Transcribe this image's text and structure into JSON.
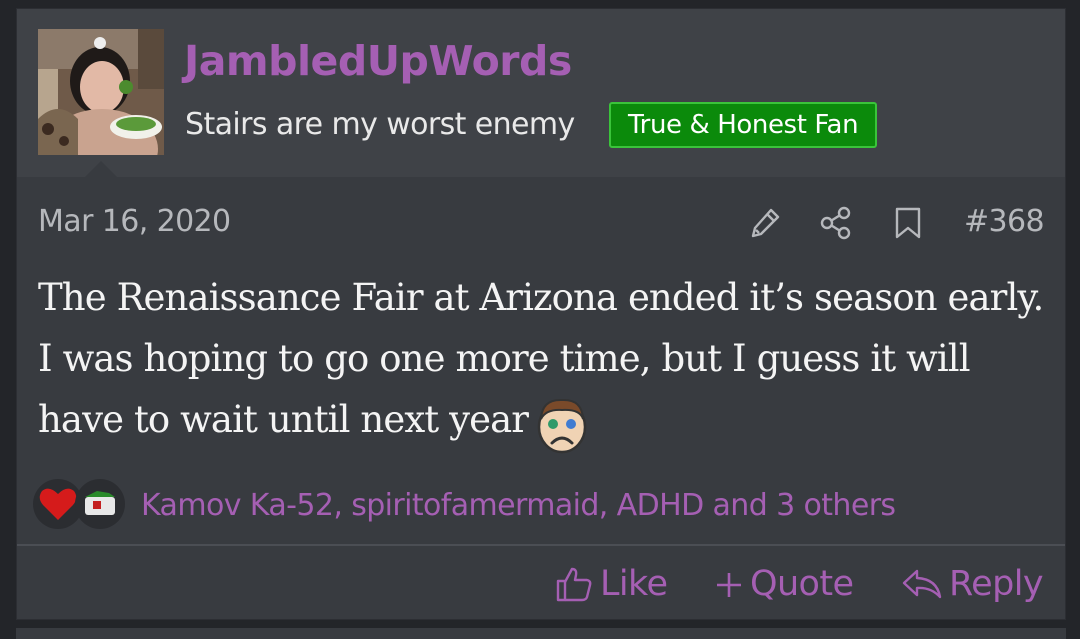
{
  "user": {
    "name": "JambledUpWords",
    "title": "Stairs are my worst enemy",
    "banner": "True & Honest Fan"
  },
  "post": {
    "date": "Mar 16, 2020",
    "number": "#368",
    "message": "The Renaissance Fair at Arizona ended it’s season early. I was hoping to go one more time, but I guess it will have to wait until next year",
    "smilie": "sad-face-smilie"
  },
  "reactions": {
    "icons": [
      "heart-reaction-icon",
      "cookie-reaction-icon"
    ],
    "list": "Kamov Ka-52, spiritofamermaid, ADHD and 3 others"
  },
  "actions": {
    "like": "Like",
    "quote": "Quote",
    "reply": "Reply"
  },
  "tools": [
    "edit-icon",
    "share-icon",
    "bookmark-icon"
  ],
  "colors": {
    "username": "#a55fb3",
    "banner_bg": "#0b8a0b",
    "banner_border": "#3ac43a",
    "post_bg": "#383b40",
    "header_bg": "#3f4247"
  }
}
